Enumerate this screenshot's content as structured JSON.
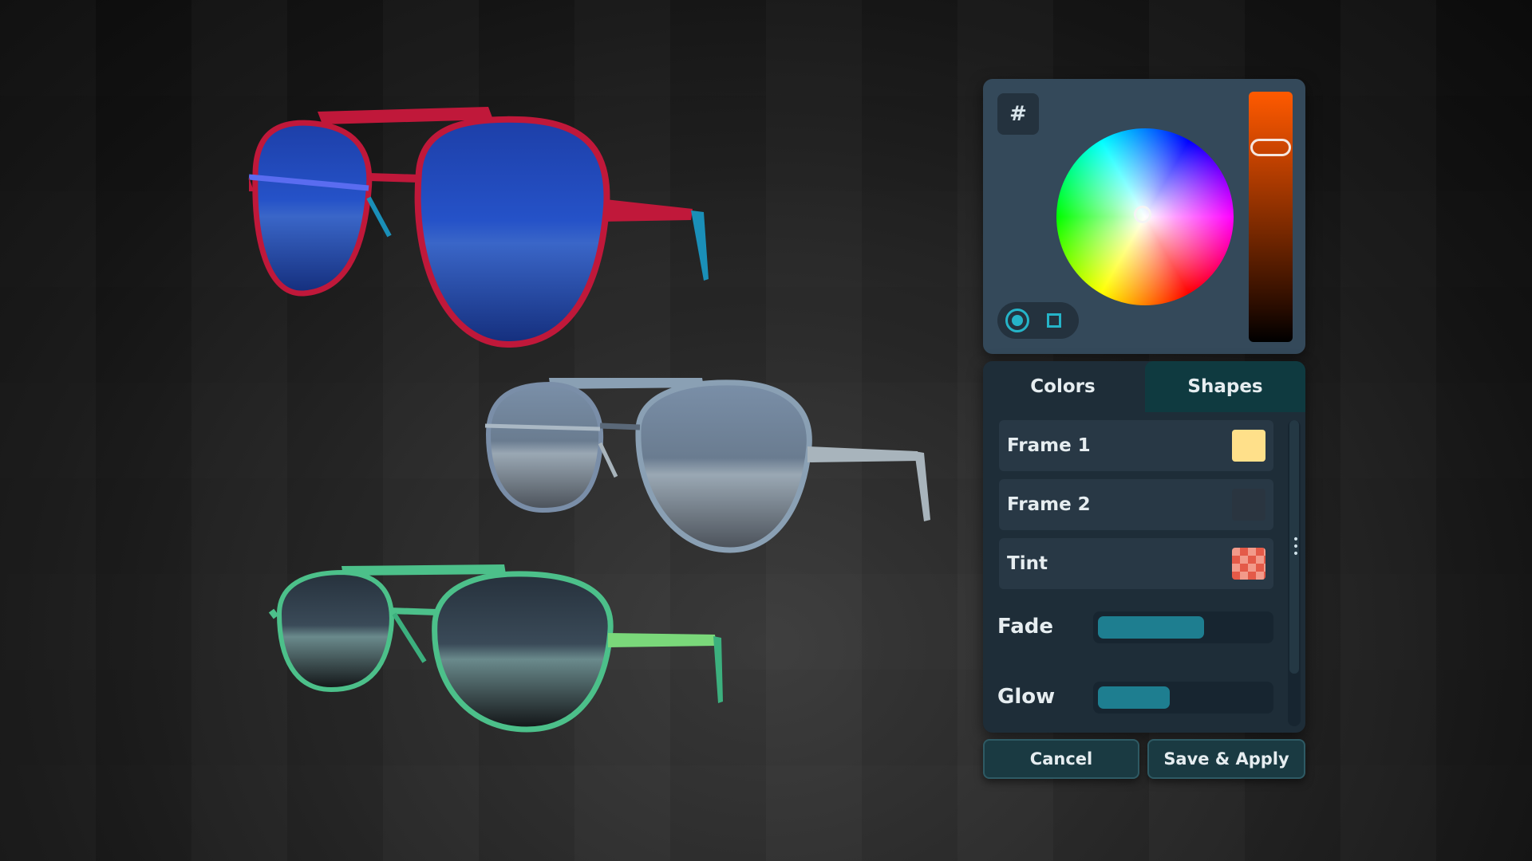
{
  "picker": {
    "hex_label": "#",
    "icons": {
      "hex": "hash-icon",
      "circle": "circle-shape-icon",
      "square": "square-shape-icon"
    }
  },
  "tabs": [
    {
      "label": "Colors",
      "active": true
    },
    {
      "label": "Shapes",
      "active": false
    }
  ],
  "color_rows": [
    {
      "label": "Frame 1",
      "color": "#ffe08a"
    },
    {
      "label": "Frame 2",
      "color": "#2a3540"
    },
    {
      "label": "Tint",
      "color": "#f29a8a"
    }
  ],
  "sliders": [
    {
      "label": "Fade",
      "value": 0.62
    },
    {
      "label": "Glow",
      "value": 0.42
    }
  ],
  "buttons": {
    "cancel": "Cancel",
    "save": "Save & Apply"
  },
  "glasses": [
    {
      "frame_color": "#c0183a",
      "lens_color": "#1a3c9c",
      "temple_tip": "#1a8fb8"
    },
    {
      "frame_color": "#8aa0b4",
      "lens_color": "#6b7888",
      "temple_tip": "#a8b4bc"
    },
    {
      "frame_color": "#4cc08a",
      "lens_color": "#1c2228",
      "temple_tip": "#3cb07e"
    }
  ]
}
